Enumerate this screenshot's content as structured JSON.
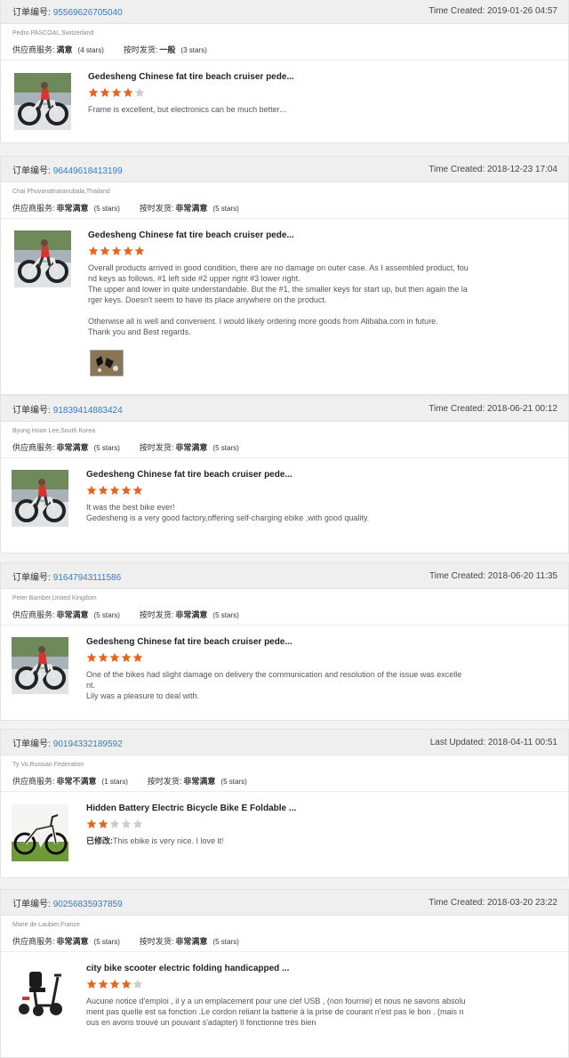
{
  "colors": {
    "accent": "#3a7bbf",
    "star_on": "#e8641c",
    "star_off": "#cccccc"
  },
  "orders": [
    {
      "order_label": "订单编号:",
      "order_id": "95569626705040",
      "time_label": "Time Created:",
      "time": "2019-01-26 04:57",
      "buyer": "Pedro PASCOAL,Switzerland",
      "supplier_label": "供应商服务:",
      "supplier_value": "满意",
      "supplier_stars": "(4 stars)",
      "delivery_label": "按时发货:",
      "delivery_value": "一般",
      "delivery_stars": "(3 stars)",
      "product_title": "Gedesheng Chinese fat tire beach cruiser pede...",
      "rating": 4,
      "thumb_icon": "bike-photo",
      "review_lines": [
        "Frame is excellent, but electronics can be much better..."
      ]
    },
    {
      "order_label": "订单编号:",
      "order_id": "96449618413199",
      "time_label": "Time Created:",
      "time": "2018-12-23 17:04",
      "buyer": "Chai Phuvanatnaranubala,Thailand",
      "supplier_label": "供应商服务:",
      "supplier_value": "非常满意",
      "supplier_stars": "(5 stars)",
      "delivery_label": "按时发货:",
      "delivery_value": "非常满意",
      "delivery_stars": "(5 stars)",
      "product_title": "Gedesheng Chinese fat tire beach cruiser pede...",
      "rating": 5,
      "thumb_icon": "bike-photo",
      "review_lines": [
        "Overall products arrived in good condition, there are no damage on outer case. As I assembled product, fou",
        "nd keys as follows. #1 left side #2 upper right #3 lower right.",
        "The upper and lower in quite understandable. But the #1, the smaller keys for start up, but then again the la",
        "rger keys. Doesn't seem to have its place anywhere on the product.",
        "",
        "Otherwise all is well and convenient. I would likely ordering more goods from Alibaba.com in future.",
        "Thank you and Best regards."
      ],
      "attachment_icon": "keys-photo"
    },
    {
      "order_label": "订单编号:",
      "order_id": "91839414883424",
      "time_label": "Time Created:",
      "time": "2018-06-21 00:12",
      "buyer": "Byung Hoon Lee,South Korea",
      "supplier_label": "供应商服务:",
      "supplier_value": "非常满意",
      "supplier_stars": "(5 stars)",
      "delivery_label": "按时发货:",
      "delivery_value": "非常满意",
      "delivery_stars": "(5 stars)",
      "product_title": "Gedesheng Chinese fat tire beach cruiser pede...",
      "rating": 5,
      "thumb_icon": "bike-photo",
      "review_lines": [
        "It was the best bike ever!",
        "Gedesheng is a very good factory,offering self-charging ebike ,with good quality."
      ]
    },
    {
      "order_label": "订单编号:",
      "order_id": "91647943111586",
      "time_label": "Time Created:",
      "time": "2018-06-20 11:35",
      "buyer": "Peter Bamber,United Kingdom",
      "supplier_label": "供应商服务:",
      "supplier_value": "非常满意",
      "supplier_stars": "(5 stars)",
      "delivery_label": "按时发货:",
      "delivery_value": "非常满意",
      "delivery_stars": "(5 stars)",
      "product_title": "Gedesheng Chinese fat tire beach cruiser pede...",
      "rating": 5,
      "thumb_icon": "bike-photo",
      "review_lines": [
        "One of the bikes had slight damage on delivery the communication and resolution of the issue was excelle",
        "nt.",
        "Lily was a pleasure to deal with."
      ]
    },
    {
      "order_label": "订单编号:",
      "order_id": "90194332189592",
      "time_label": "Last Updated:",
      "time": "2018-04-11 00:51",
      "buyer": "Ty Vo,Russian Federation",
      "supplier_label": "供应商服务:",
      "supplier_value": "非常不满意",
      "supplier_stars": "(1 stars)",
      "delivery_label": "按时发货:",
      "delivery_value": "非常满意",
      "delivery_stars": "(5 stars)",
      "product_title": "Hidden Battery Electric Bicycle Bike E Foldable ...",
      "rating": 2,
      "thumb_icon": "folding-bike-photo",
      "edited_label": "已修改:",
      "review_lines": [
        "This ebike is very nice. I love it!"
      ]
    },
    {
      "order_label": "订单编号:",
      "order_id": "90256835937859",
      "time_label": "Time Created:",
      "time": "2018-03-20 23:22",
      "buyer": "Marie de Laubier,France",
      "supplier_label": "供应商服务:",
      "supplier_value": "非常满意",
      "supplier_stars": "(5 stars)",
      "delivery_label": "按时发货:",
      "delivery_value": "非常满意",
      "delivery_stars": "(5 stars)",
      "product_title": "city bike scooter electric folding handicapped ...",
      "rating": 4,
      "thumb_icon": "scooter-photo",
      "review_lines": [
        "Aucune notice d'emploi , il y a un emplacement pour une clef USB , (non fournie) et nous ne savons absolu",
        "ment pas quelle est sa fonction .Le cordon reliant la batterie à la prise de courant n'est pas le bon . (mais n",
        "ous en avons trouvé un pouvant s'adapter) Il fonctionne très bien"
      ]
    }
  ]
}
